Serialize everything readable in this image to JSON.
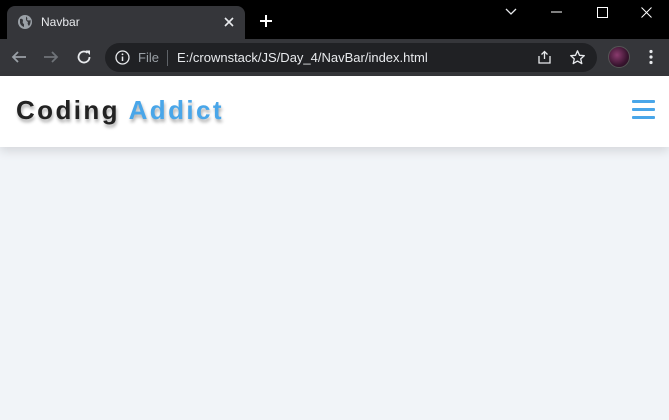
{
  "browser": {
    "tab_title": "Navbar",
    "omnibox": {
      "scheme_label": "File",
      "url": "E:/crownstack/JS/Day_4/NavBar/index.html"
    }
  },
  "page": {
    "logo": {
      "part1": "Coding",
      "part2": "Addict"
    }
  },
  "icons": {
    "tab": "globe-icon",
    "tab_close": "close-icon",
    "new_tab": "plus-icon",
    "tab_search": "chevron-down-icon",
    "minimize": "minimize-icon",
    "maximize": "maximize-icon",
    "close": "close-icon",
    "back": "back-arrow-icon",
    "forward": "forward-arrow-icon",
    "reload": "reload-icon",
    "info": "info-icon",
    "share": "share-icon",
    "bookmark": "star-icon",
    "profile": "avatar",
    "menu": "kebab-menu-icon",
    "hamburger": "hamburger-menu-icon"
  },
  "colors": {
    "accent": "#49a6e9",
    "page_bg": "#f1f4f8",
    "navbar_bg": "#ffffff",
    "chrome_frame": "#000000",
    "chrome_toolbar": "#35363a",
    "omnibox_bg": "#202124"
  }
}
